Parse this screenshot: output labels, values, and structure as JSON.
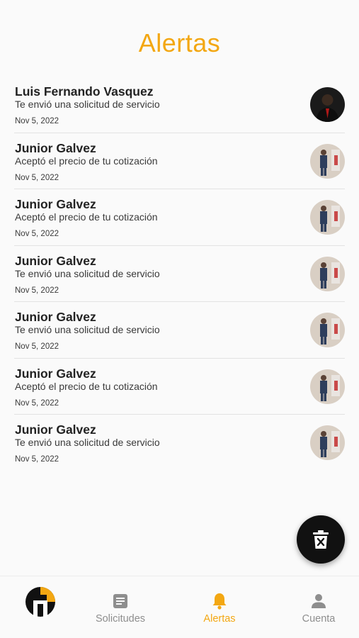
{
  "header": {
    "title": "Alertas"
  },
  "alerts": [
    {
      "name": "Luis Fernando Vasquez",
      "message": "Te envió una solicitud de servicio",
      "date": "Nov 5, 2022",
      "avatar": "dark-avatar"
    },
    {
      "name": "Junior Galvez",
      "message": "Aceptó el precio de tu cotización",
      "date": "Nov 5, 2022",
      "avatar": "light-avatar"
    },
    {
      "name": "Junior Galvez",
      "message": "Aceptó el precio de tu cotización",
      "date": "Nov 5, 2022",
      "avatar": "light-avatar"
    },
    {
      "name": "Junior Galvez",
      "message": "Te envió una solicitud de servicio",
      "date": "Nov 5, 2022",
      "avatar": "light-avatar"
    },
    {
      "name": "Junior Galvez",
      "message": "Te envió una solicitud de servicio",
      "date": "Nov 5, 2022",
      "avatar": "light-avatar"
    },
    {
      "name": "Junior Galvez",
      "message": "Aceptó el precio de tu cotización",
      "date": "Nov 5, 2022",
      "avatar": "light-avatar"
    },
    {
      "name": "Junior Galvez",
      "message": "Te envió una solicitud de servicio",
      "date": "Nov 5, 2022",
      "avatar": "light-avatar"
    }
  ],
  "fab": {
    "icon": "delete-icon"
  },
  "nav": {
    "items": [
      {
        "label": "",
        "icon": "logo-icon"
      },
      {
        "label": "Solicitudes",
        "icon": "document-icon"
      },
      {
        "label": "Alertas",
        "icon": "bell-icon"
      },
      {
        "label": "Cuenta",
        "icon": "person-icon"
      }
    ],
    "active": "Alertas"
  },
  "colors": {
    "accent": "#f3a712",
    "inactive": "#8e8e8e",
    "fab": "#111111"
  }
}
